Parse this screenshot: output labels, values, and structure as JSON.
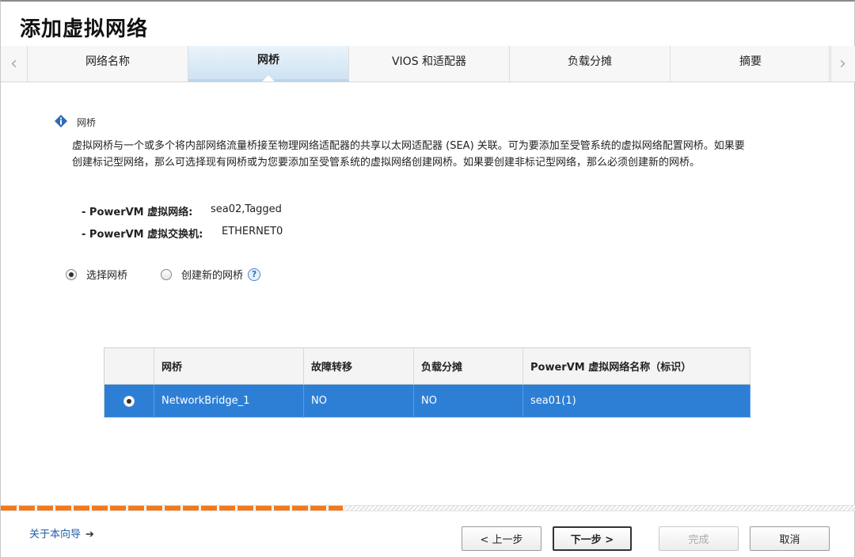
{
  "title": "添加虚拟网络",
  "tabs": [
    {
      "label": "网络名称",
      "active": false
    },
    {
      "label": "网桥",
      "active": true
    },
    {
      "label": "VIOS 和适配器",
      "active": false
    },
    {
      "label": "负载分摊",
      "active": false
    },
    {
      "label": "摘要",
      "active": false
    }
  ],
  "info": {
    "heading": "网桥",
    "body": "虚拟网桥与一个或多个将内部网络流量桥接至物理网络适配器的共享以太网适配器 (SEA) 关联。可为要添加至受管系统的虚拟网络配置网桥。如果要创建标记型网络，那么可选择现有网桥或为您要添加至受管系统的虚拟网络创建网桥。如果要创建非标记型网络，那么必须创建新的网桥。",
    "network_label": "- PowerVM 虚拟网络:",
    "network_value": "sea02,Tagged",
    "switch_label": "- PowerVM 虚拟交换机:",
    "switch_value": "ETHERNET0"
  },
  "options": {
    "select_bridge": "选择网桥",
    "create_bridge": "创建新的网桥",
    "selected": "select_bridge"
  },
  "table": {
    "headers": [
      "",
      "网桥",
      "故障转移",
      "负载分摊",
      "PowerVM 虚拟网络名称（标识）"
    ],
    "rows": [
      {
        "bridge": "NetworkBridge_1",
        "failover": "NO",
        "load": "NO",
        "network": "sea01(1)",
        "selected": true
      }
    ]
  },
  "progress": 0.4,
  "footer": {
    "about": "关于本向导",
    "prev": "< 上一步",
    "next": "下一步 >",
    "finish": "完成",
    "cancel": "取消"
  },
  "colors": {
    "accent": "#2d7fd6",
    "progress": "#f07a20",
    "link": "#1f5fa8"
  }
}
